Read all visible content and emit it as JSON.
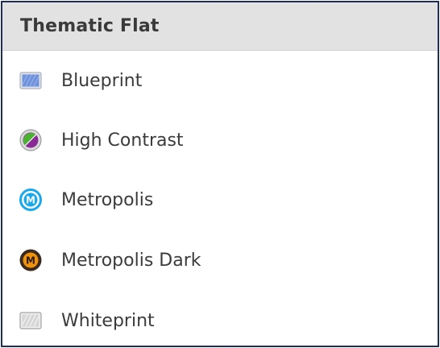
{
  "panel": {
    "title": "Thematic Flat"
  },
  "themes": [
    {
      "label": "Blueprint",
      "icon": "blueprint-swatch-icon"
    },
    {
      "label": "High Contrast",
      "icon": "high-contrast-circle-icon"
    },
    {
      "label": "Metropolis",
      "icon": "metropolis-m-icon"
    },
    {
      "label": "Metropolis Dark",
      "icon": "metropolis-dark-m-icon"
    },
    {
      "label": "Whiteprint",
      "icon": "whiteprint-swatch-icon"
    }
  ],
  "colors": {
    "frame_border": "#1f2d5a",
    "header_background": "#e2e2e2",
    "blueprint": "#5f86d6",
    "metropolis": "#18a8ec",
    "metropolis_dark": "#f0920a",
    "high_contrast_green": "#49b32f",
    "high_contrast_purple": "#8a2a96"
  }
}
